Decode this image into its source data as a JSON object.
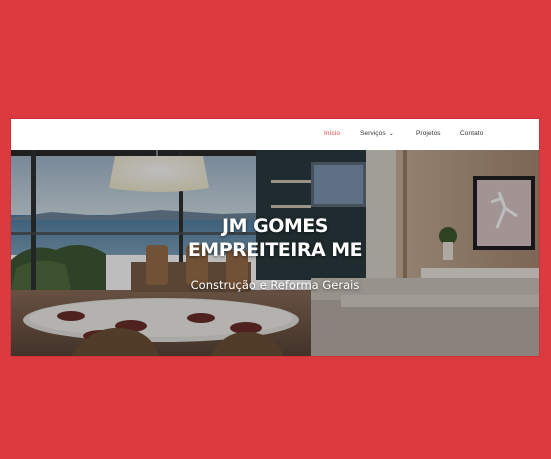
{
  "nav": {
    "items": [
      {
        "label": "Início",
        "active": true
      },
      {
        "label": "Serviços",
        "has_dropdown": true
      },
      {
        "label": "Projetos"
      },
      {
        "label": "Contato"
      }
    ]
  },
  "hero": {
    "title_line1": "JM GOMES",
    "title_line2": "EMPREITEIRA ME",
    "subtitle": "Construção e Reforma Gerais"
  },
  "colors": {
    "page_background": "#dd3a3f",
    "nav_active": "#e2474b",
    "nav_text": "#333333"
  }
}
